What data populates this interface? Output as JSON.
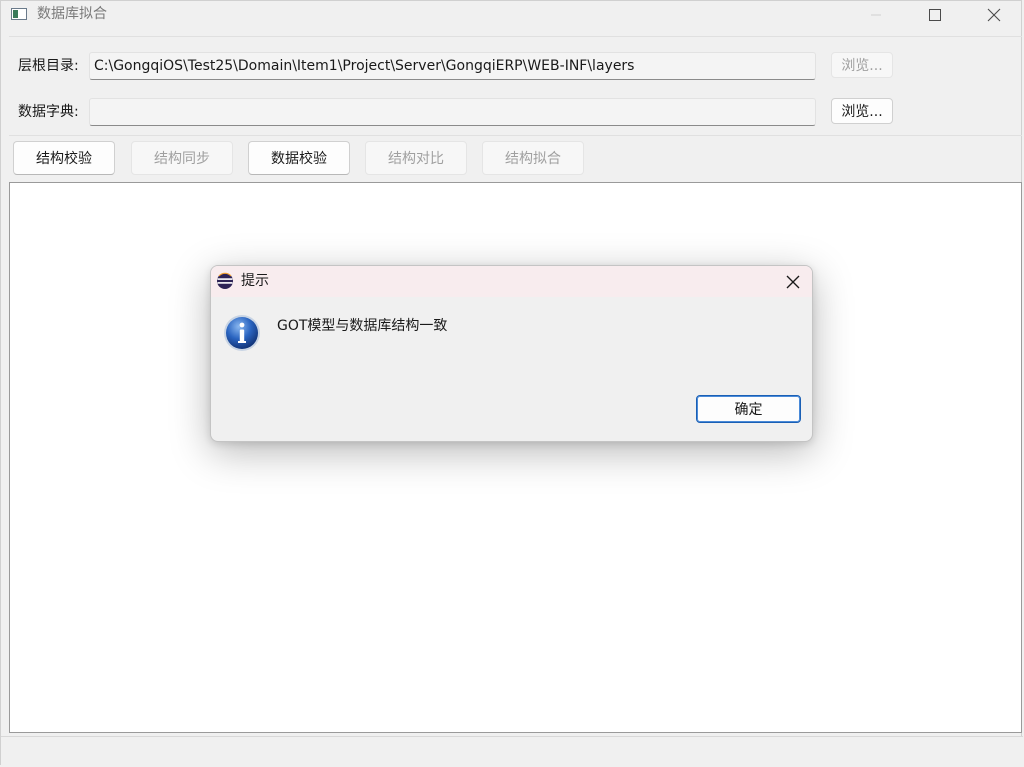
{
  "window": {
    "title": "数据库拟合"
  },
  "fields": {
    "root_dir_label": "层根目录:",
    "root_dir_value": "C:\\GongqiOS\\Test25\\Domain\\Item1\\Project\\Server\\GongqiERP\\WEB-INF\\layers",
    "dict_label": "数据字典:",
    "dict_value": "",
    "browse_label": "浏览...",
    "browse_label_2": "浏览..."
  },
  "toolbar": {
    "buttons": [
      {
        "label": "结构校验",
        "enabled": true
      },
      {
        "label": "结构同步",
        "enabled": false
      },
      {
        "label": "数据校验",
        "enabled": true
      },
      {
        "label": "结构对比",
        "enabled": false
      },
      {
        "label": "结构拟合",
        "enabled": false
      }
    ]
  },
  "dialog": {
    "title": "提示",
    "message": "GOT模型与数据库结构一致",
    "ok_label": "确定"
  },
  "icons": {
    "app": "app-window-icon",
    "minimize": "minimize-icon",
    "maximize": "maximize-icon",
    "close": "close-icon",
    "dialog_app": "eclipse-icon",
    "info": "info-icon"
  },
  "colors": {
    "accent": "#1a5fb4",
    "dialog_titlebar": "#f8ecee",
    "disabled_text": "#a0a0a0"
  }
}
